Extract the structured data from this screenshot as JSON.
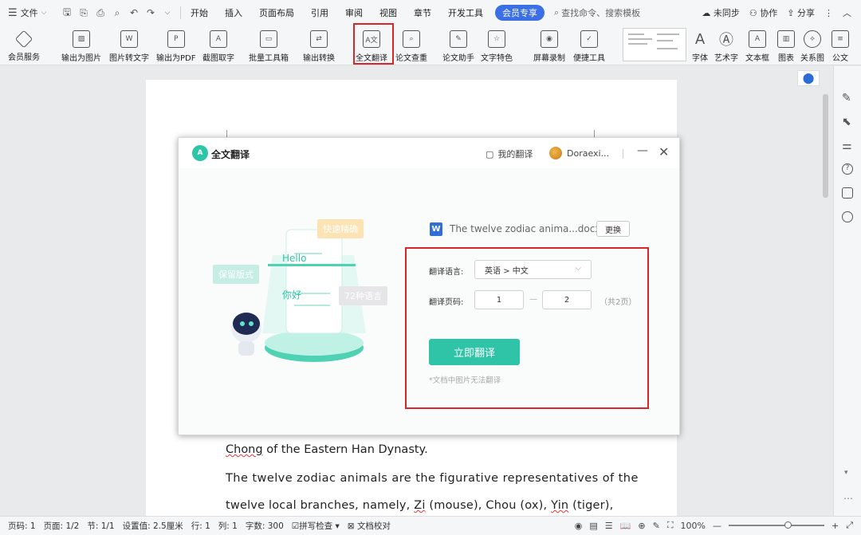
{
  "menubar": {
    "file_label": "文件",
    "tabs": [
      "开始",
      "插入",
      "页面布局",
      "引用",
      "审阅",
      "视图",
      "章节",
      "开发工具"
    ],
    "member_tab": "会员专享",
    "search_placeholder": "查找命令、搜索模板",
    "not_synced": "未同步",
    "collab": "协作",
    "share": "分享"
  },
  "ribbon": {
    "items": [
      "会员服务",
      "输出为图片",
      "图片转文字",
      "输出为PDF",
      "截图取字",
      "批量工具箱",
      "输出转换",
      "全文翻译",
      "论文查重",
      "论文助手",
      "文字特色",
      "屏幕录制",
      "便捷工具",
      "字体",
      "艺术字",
      "文本框",
      "图表",
      "关系图",
      "公文"
    ]
  },
  "document": {
    "lines": [
      [
        "Chong",
        " of the Eastern Han Dynasty."
      ],
      [
        "The twelve zodiac animals are the figurative representatives of the"
      ],
      [
        "twelve local branches, namely, ",
        "Zi",
        " (mouse), Chou (ox), ",
        "Yin",
        " (tiger),"
      ]
    ]
  },
  "dialog": {
    "title": "全文翻译",
    "my_translations": "我的翻译",
    "user": "Doraexi...",
    "file_name": "The twelve zodiac anima...docx",
    "change_button": "更换",
    "lang_label": "翻译语言:",
    "lang_value": "英语 > 中文",
    "pages_label": "翻译页码:",
    "page_from": "1",
    "page_to": "2",
    "page_sep": "—",
    "page_total": "（共2页）",
    "translate_button": "立即翻译",
    "note": "*文档中图片无法翻译",
    "illustration": {
      "tag_fast": "快速精确",
      "tag_keep": "保留版式",
      "tag_langs": "72种语言",
      "hello": "Hello",
      "nihao": "你好"
    }
  },
  "statusbar": {
    "items": [
      "页码: 1",
      "页面: 1/2",
      "节: 1/1",
      "设置值: 2.5厘米",
      "行: 1",
      "列: 1",
      "字数: 300",
      "拼写检查",
      "文档校对"
    ],
    "zoom": "100%"
  },
  "colors": {
    "accent_teal": "#2fc3a8",
    "highlight_red": "#d9262b",
    "member_blue": "#3b6fe5"
  }
}
